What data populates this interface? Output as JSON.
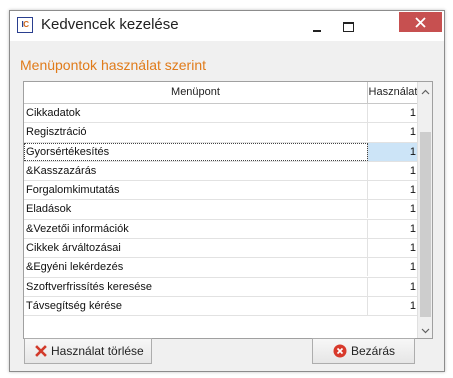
{
  "window": {
    "title": "Kedvencek kezelése",
    "icon_text_a": "I",
    "icon_text_b": "C"
  },
  "section_title": "Menüpontok használat szerint",
  "table": {
    "columns": [
      "Menüpont",
      "Használat"
    ],
    "rows": [
      {
        "name": "Cikkadatok",
        "value": "1"
      },
      {
        "name": "Regisztráció",
        "value": "1"
      },
      {
        "name": "Gyorsértékesítés",
        "value": "1",
        "focused": true
      },
      {
        "name": "&Kasszazárás",
        "value": "1"
      },
      {
        "name": "Forgalomkimutatás",
        "value": "1"
      },
      {
        "name": "Eladások",
        "value": "1"
      },
      {
        "name": "&Vezetői információk",
        "value": "1"
      },
      {
        "name": "Cikkek árváltozásai",
        "value": "1"
      },
      {
        "name": "&Egyéni lekérdezés",
        "value": "1"
      },
      {
        "name": "Szoftverfrissítés keresése",
        "value": "1"
      },
      {
        "name": "Távsegítség kérése",
        "value": "1"
      }
    ]
  },
  "buttons": {
    "clear_label": "Használat törlése",
    "close_label": "Bezárás"
  },
  "icons": {
    "app": "app-logo-icon",
    "minimize": "minimize-icon",
    "maximize": "maximize-icon",
    "close": "close-icon",
    "clear": "red-x-icon",
    "close_button": "red-circle-x-icon"
  },
  "colors": {
    "section_title": "#e07b1a",
    "close_button_bg": "#c75050",
    "selected_cell": "#cce4f7"
  }
}
